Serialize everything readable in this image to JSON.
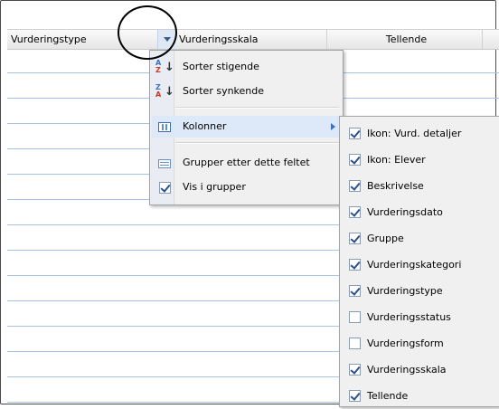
{
  "grid": {
    "columns": [
      "Vurderingstype",
      "Vurderingsskala",
      "Tellende"
    ],
    "row_count": 14
  },
  "column_menu": {
    "items": [
      {
        "label": "Sorter stigende",
        "icon": "sort-ascending-icon"
      },
      {
        "label": "Sorter synkende",
        "icon": "sort-descending-icon"
      },
      {
        "label": "Kolonner",
        "icon": "columns-icon",
        "has_submenu": true
      },
      {
        "label": "Grupper etter dette feltet",
        "icon": "group-by-icon"
      },
      {
        "label": "Vis i grupper",
        "checked": true
      }
    ]
  },
  "columns_submenu": {
    "items": [
      {
        "label": "Ikon: Vurd. detaljer",
        "checked": true
      },
      {
        "label": "Ikon: Elever",
        "checked": true
      },
      {
        "label": "Beskrivelse",
        "checked": true
      },
      {
        "label": "Vurderingsdato",
        "checked": true
      },
      {
        "label": "Gruppe",
        "checked": true
      },
      {
        "label": "Vurderingskategori",
        "checked": true
      },
      {
        "label": "Vurderingstype",
        "checked": true
      },
      {
        "label": "Vurderingsstatus",
        "checked": false
      },
      {
        "label": "Vurderingsform",
        "checked": false
      },
      {
        "label": "Vurderingsskala",
        "checked": true
      },
      {
        "label": "Tellende",
        "checked": true
      }
    ]
  },
  "colors": {
    "row_line": "#aac3e4",
    "menu_bg": "#f0f0f0",
    "highlight": "#dde9f8",
    "annotation": "#000000"
  }
}
